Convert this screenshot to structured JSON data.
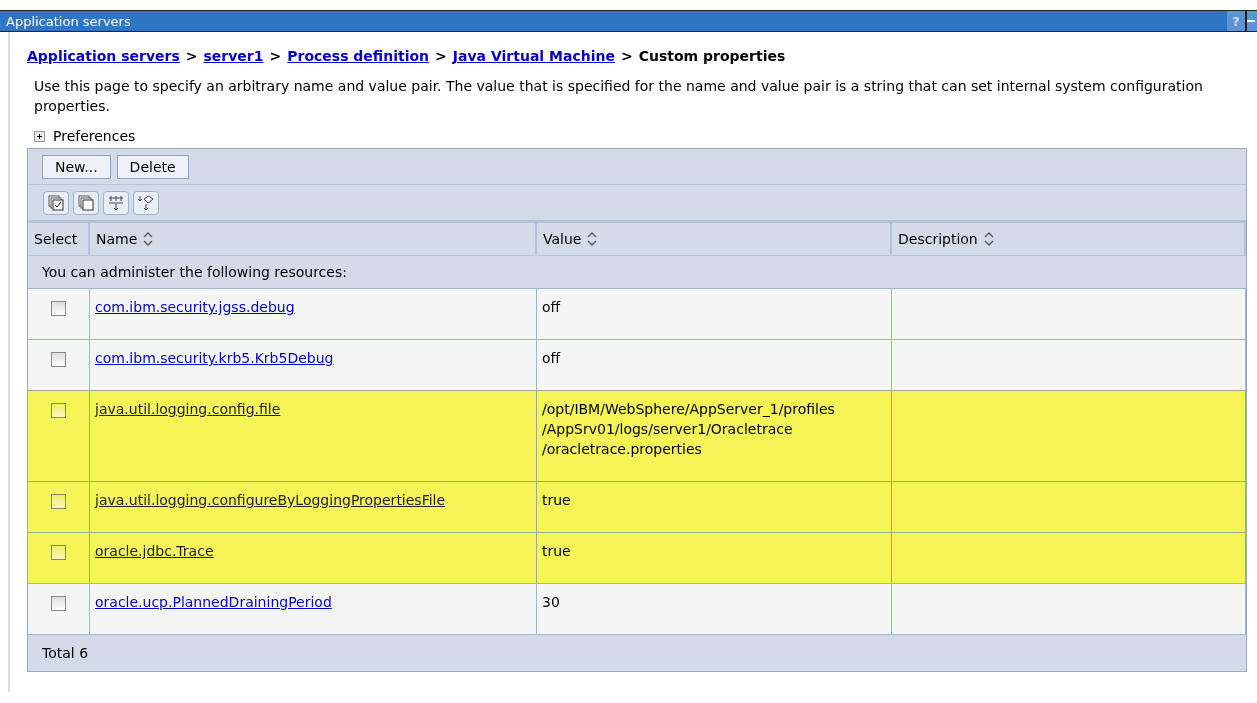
{
  "window": {
    "title": "Application servers",
    "help_button": "?"
  },
  "breadcrumb": [
    {
      "label": "Application servers",
      "kind": "link"
    },
    {
      "label": ">",
      "kind": "separator"
    },
    {
      "label": "server1",
      "kind": "link"
    },
    {
      "label": ">",
      "kind": "separator"
    },
    {
      "label": "Process definition",
      "kind": "link"
    },
    {
      "label": ">",
      "kind": "separator"
    },
    {
      "label": "Java Virtual Machine",
      "kind": "link"
    },
    {
      "label": ">",
      "kind": "separator"
    },
    {
      "label": "Custom properties",
      "kind": "current"
    }
  ],
  "description": "Use this page to specify an arbitrary name and value pair. The value that is specified for the name and value pair is a string that can set internal system configuration properties.",
  "preferences": {
    "label": "Preferences",
    "expanded": false
  },
  "buttons": [
    "New...",
    "Delete"
  ],
  "table": {
    "columns": [
      {
        "label": "Select",
        "sortable": false
      },
      {
        "label": "Name",
        "sortable": true
      },
      {
        "label": "Value",
        "sortable": true
      },
      {
        "label": "Description",
        "sortable": true
      }
    ],
    "caption": "You can administer the following resources:",
    "rows": [
      {
        "name": "com.ibm.security.jgss.debug",
        "value": "off",
        "checked": false,
        "highlighted": false
      },
      {
        "name": "com.ibm.security.krb5.Krb5Debug",
        "value": "off",
        "checked": false,
        "highlighted": false
      },
      {
        "name": "java.util.logging.config.file",
        "value": "/opt/IBM/WebSphere/AppServer_1/profiles/AppSrv01/logs/server1/Oracletrace/oracletrace.properties",
        "checked": false,
        "highlighted": true
      },
      {
        "name": "java.util.logging.configureByLoggingPropertiesFile",
        "value": "true",
        "checked": false,
        "highlighted": true
      },
      {
        "name": "oracle.jdbc.Trace",
        "value": "true",
        "checked": false,
        "highlighted": true
      },
      {
        "name": "oracle.ucp.PlannedDrainingPeriod",
        "value": "30",
        "checked": false,
        "highlighted": false
      }
    ],
    "total": "Total 6"
  }
}
